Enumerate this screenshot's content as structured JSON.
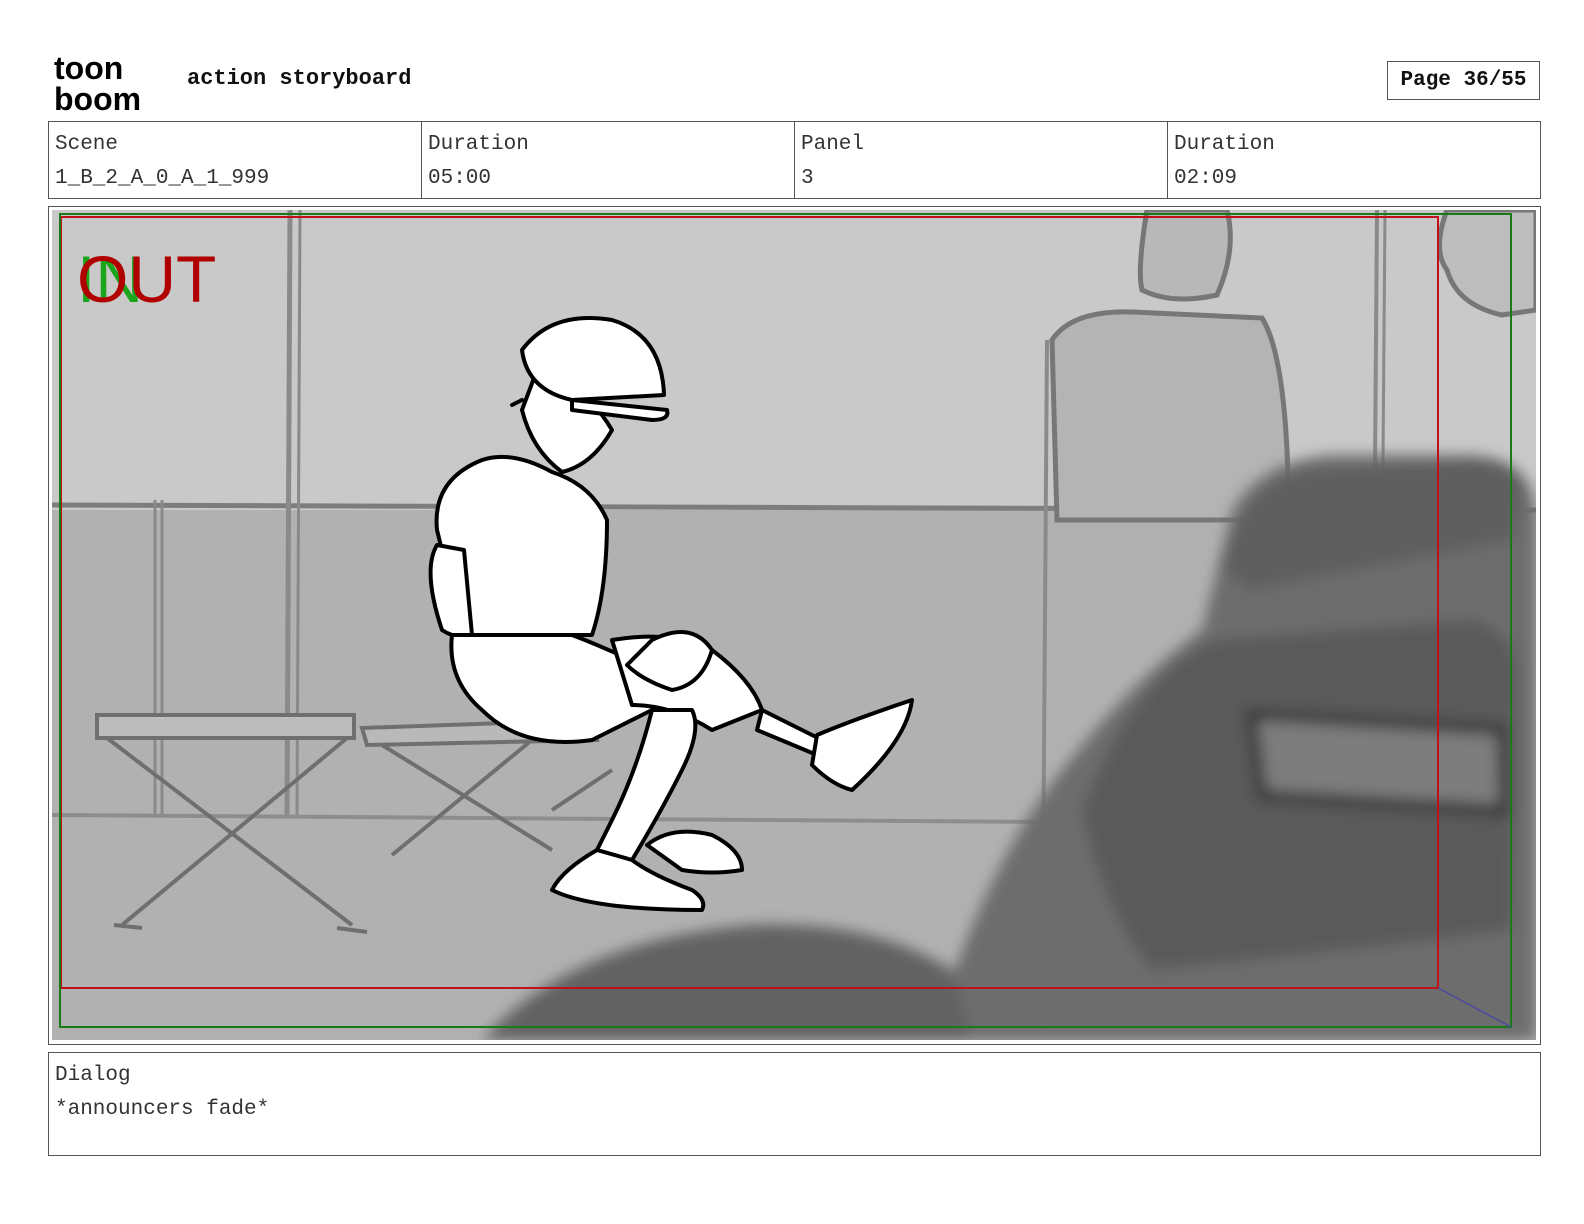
{
  "header": {
    "logo_top": "toon",
    "logo_bottom": "boom",
    "title": "action storyboard",
    "page": "Page 36/55"
  },
  "info": {
    "scene_label": "Scene",
    "scene_value": "1_B_2_A_0_A_1_999",
    "scene_duration_label": "Duration",
    "scene_duration_value": "05:00",
    "panel_label": "Panel",
    "panel_value": "3",
    "panel_duration_label": "Duration",
    "panel_duration_value": "02:09"
  },
  "panel": {
    "in_marker": "IN",
    "out_marker": "OUT",
    "colors": {
      "in": "#1aa51a",
      "out": "#b00000",
      "safe_frame": "#c0101a",
      "camera_frame": "#1a7a1a"
    }
  },
  "dialog": {
    "label": "Dialog",
    "text": "*announcers fade*"
  }
}
